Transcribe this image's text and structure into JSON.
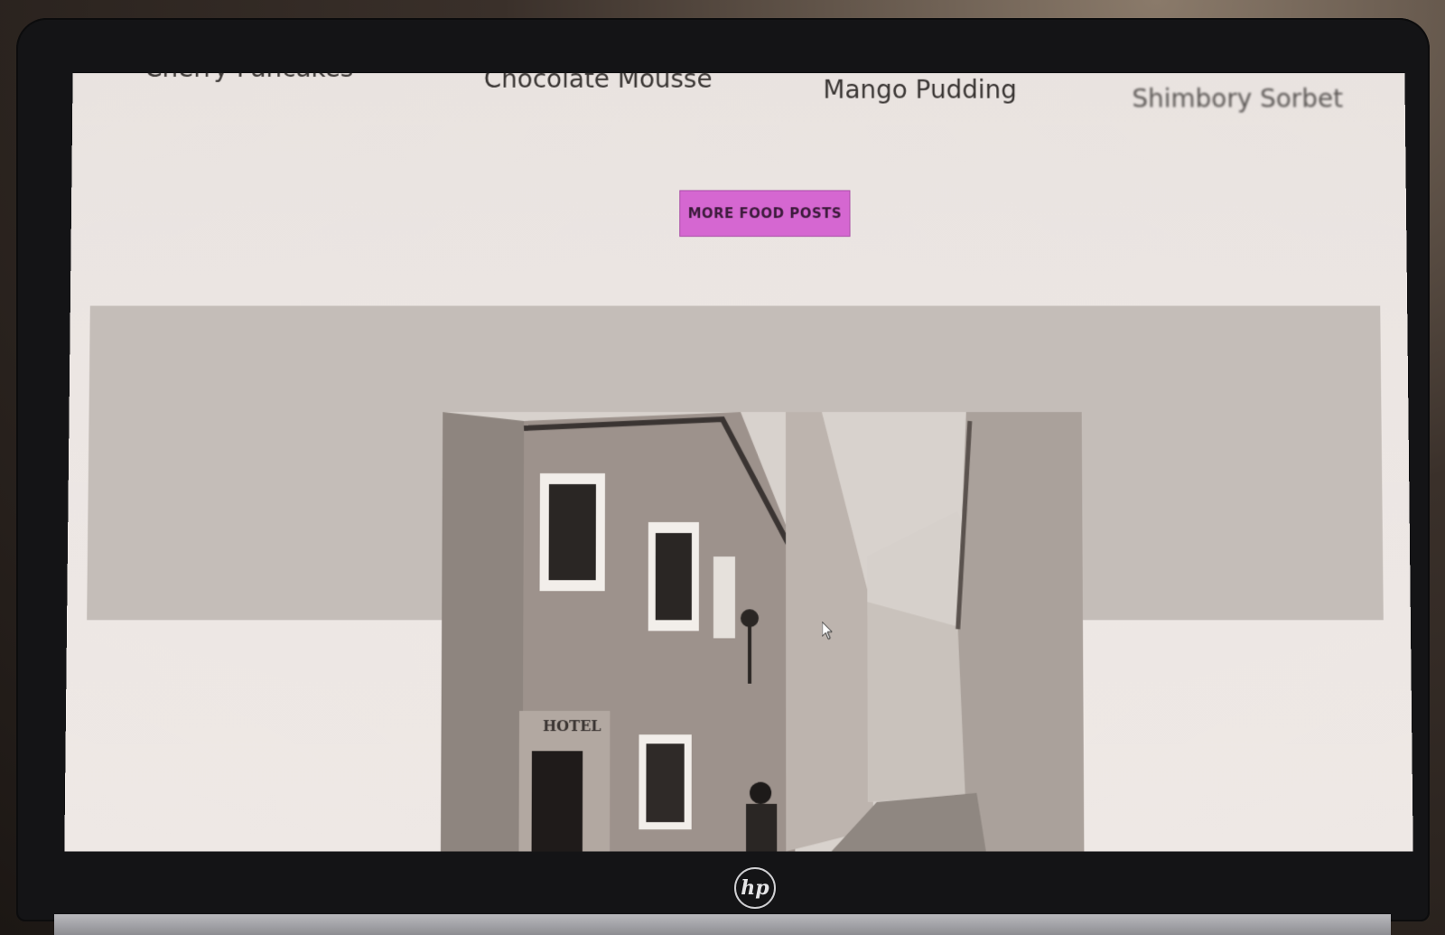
{
  "posts": {
    "titles": [
      "Cherry Pancakes",
      "Chocolate Mousse",
      "Mango Pudding",
      "Shimbory Sorbet"
    ]
  },
  "cta": {
    "more_label": "MORE FOOD POSTS",
    "color": "#d567d1"
  },
  "feature_image": {
    "sign_text": "HOTEL"
  },
  "device": {
    "brand": "hp"
  }
}
